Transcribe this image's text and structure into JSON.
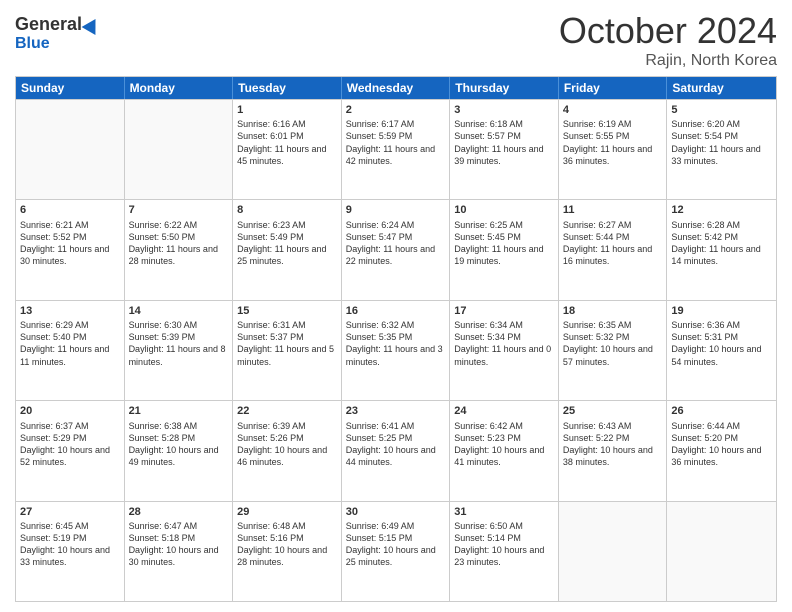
{
  "header": {
    "logo_general": "General",
    "logo_blue": "Blue",
    "title_month": "October 2024",
    "title_location": "Rajin, North Korea"
  },
  "days_of_week": [
    "Sunday",
    "Monday",
    "Tuesday",
    "Wednesday",
    "Thursday",
    "Friday",
    "Saturday"
  ],
  "weeks": [
    [
      {
        "day": "",
        "info": ""
      },
      {
        "day": "",
        "info": ""
      },
      {
        "day": "1",
        "info": "Sunrise: 6:16 AM\nSunset: 6:01 PM\nDaylight: 11 hours and 45 minutes."
      },
      {
        "day": "2",
        "info": "Sunrise: 6:17 AM\nSunset: 5:59 PM\nDaylight: 11 hours and 42 minutes."
      },
      {
        "day": "3",
        "info": "Sunrise: 6:18 AM\nSunset: 5:57 PM\nDaylight: 11 hours and 39 minutes."
      },
      {
        "day": "4",
        "info": "Sunrise: 6:19 AM\nSunset: 5:55 PM\nDaylight: 11 hours and 36 minutes."
      },
      {
        "day": "5",
        "info": "Sunrise: 6:20 AM\nSunset: 5:54 PM\nDaylight: 11 hours and 33 minutes."
      }
    ],
    [
      {
        "day": "6",
        "info": "Sunrise: 6:21 AM\nSunset: 5:52 PM\nDaylight: 11 hours and 30 minutes."
      },
      {
        "day": "7",
        "info": "Sunrise: 6:22 AM\nSunset: 5:50 PM\nDaylight: 11 hours and 28 minutes."
      },
      {
        "day": "8",
        "info": "Sunrise: 6:23 AM\nSunset: 5:49 PM\nDaylight: 11 hours and 25 minutes."
      },
      {
        "day": "9",
        "info": "Sunrise: 6:24 AM\nSunset: 5:47 PM\nDaylight: 11 hours and 22 minutes."
      },
      {
        "day": "10",
        "info": "Sunrise: 6:25 AM\nSunset: 5:45 PM\nDaylight: 11 hours and 19 minutes."
      },
      {
        "day": "11",
        "info": "Sunrise: 6:27 AM\nSunset: 5:44 PM\nDaylight: 11 hours and 16 minutes."
      },
      {
        "day": "12",
        "info": "Sunrise: 6:28 AM\nSunset: 5:42 PM\nDaylight: 11 hours and 14 minutes."
      }
    ],
    [
      {
        "day": "13",
        "info": "Sunrise: 6:29 AM\nSunset: 5:40 PM\nDaylight: 11 hours and 11 minutes."
      },
      {
        "day": "14",
        "info": "Sunrise: 6:30 AM\nSunset: 5:39 PM\nDaylight: 11 hours and 8 minutes."
      },
      {
        "day": "15",
        "info": "Sunrise: 6:31 AM\nSunset: 5:37 PM\nDaylight: 11 hours and 5 minutes."
      },
      {
        "day": "16",
        "info": "Sunrise: 6:32 AM\nSunset: 5:35 PM\nDaylight: 11 hours and 3 minutes."
      },
      {
        "day": "17",
        "info": "Sunrise: 6:34 AM\nSunset: 5:34 PM\nDaylight: 11 hours and 0 minutes."
      },
      {
        "day": "18",
        "info": "Sunrise: 6:35 AM\nSunset: 5:32 PM\nDaylight: 10 hours and 57 minutes."
      },
      {
        "day": "19",
        "info": "Sunrise: 6:36 AM\nSunset: 5:31 PM\nDaylight: 10 hours and 54 minutes."
      }
    ],
    [
      {
        "day": "20",
        "info": "Sunrise: 6:37 AM\nSunset: 5:29 PM\nDaylight: 10 hours and 52 minutes."
      },
      {
        "day": "21",
        "info": "Sunrise: 6:38 AM\nSunset: 5:28 PM\nDaylight: 10 hours and 49 minutes."
      },
      {
        "day": "22",
        "info": "Sunrise: 6:39 AM\nSunset: 5:26 PM\nDaylight: 10 hours and 46 minutes."
      },
      {
        "day": "23",
        "info": "Sunrise: 6:41 AM\nSunset: 5:25 PM\nDaylight: 10 hours and 44 minutes."
      },
      {
        "day": "24",
        "info": "Sunrise: 6:42 AM\nSunset: 5:23 PM\nDaylight: 10 hours and 41 minutes."
      },
      {
        "day": "25",
        "info": "Sunrise: 6:43 AM\nSunset: 5:22 PM\nDaylight: 10 hours and 38 minutes."
      },
      {
        "day": "26",
        "info": "Sunrise: 6:44 AM\nSunset: 5:20 PM\nDaylight: 10 hours and 36 minutes."
      }
    ],
    [
      {
        "day": "27",
        "info": "Sunrise: 6:45 AM\nSunset: 5:19 PM\nDaylight: 10 hours and 33 minutes."
      },
      {
        "day": "28",
        "info": "Sunrise: 6:47 AM\nSunset: 5:18 PM\nDaylight: 10 hours and 30 minutes."
      },
      {
        "day": "29",
        "info": "Sunrise: 6:48 AM\nSunset: 5:16 PM\nDaylight: 10 hours and 28 minutes."
      },
      {
        "day": "30",
        "info": "Sunrise: 6:49 AM\nSunset: 5:15 PM\nDaylight: 10 hours and 25 minutes."
      },
      {
        "day": "31",
        "info": "Sunrise: 6:50 AM\nSunset: 5:14 PM\nDaylight: 10 hours and 23 minutes."
      },
      {
        "day": "",
        "info": ""
      },
      {
        "day": "",
        "info": ""
      }
    ]
  ]
}
